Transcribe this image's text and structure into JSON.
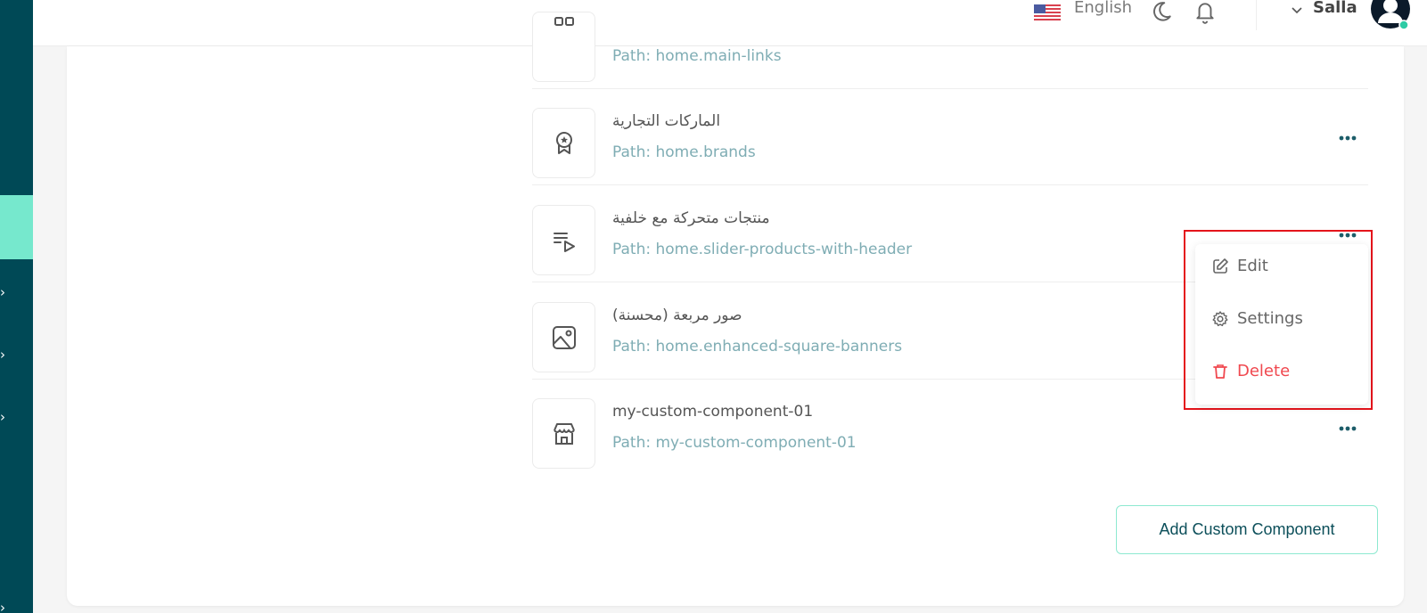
{
  "header": {
    "language": {
      "label": "English",
      "flag": "us-flag-icon"
    },
    "theme_toggle_icon": "moon-icon",
    "notifications_icon": "bell-icon",
    "user": {
      "name": "Salla",
      "status_color": "#2ecba5"
    }
  },
  "sidebar": {
    "background": "#004956",
    "active_color": "#76e8cd",
    "expand_icons": [
      "chevron-right-icon",
      "chevron-right-icon",
      "chevron-right-icon",
      "chevron-right-icon"
    ]
  },
  "components": [
    {
      "title": "",
      "path": "Path: home.main-links",
      "icon": "grid-icon"
    },
    {
      "title": "الماركات التجارية",
      "path": "Path: home.brands",
      "icon": "award-icon"
    },
    {
      "title": "منتجات متحركة مع خلفية",
      "path": "Path: home.slider-products-with-header",
      "icon": "playlist-icon"
    },
    {
      "title": "صور مربعة (محسنة)",
      "path": "Path: home.enhanced-square-banners",
      "icon": "image-icon"
    },
    {
      "title": "my-custom-component-01",
      "path": "Path: my-custom-component-01",
      "icon": "store-icon"
    }
  ],
  "context_menu": {
    "items": [
      {
        "label": "Edit",
        "icon": "edit-icon"
      },
      {
        "label": "Settings",
        "icon": "gear-icon"
      },
      {
        "label": "Delete",
        "icon": "trash-icon",
        "color": "#f0484f"
      }
    ],
    "highlight_color": "#e4141b"
  },
  "actions": {
    "add_custom_component": "Add Custom Component"
  }
}
